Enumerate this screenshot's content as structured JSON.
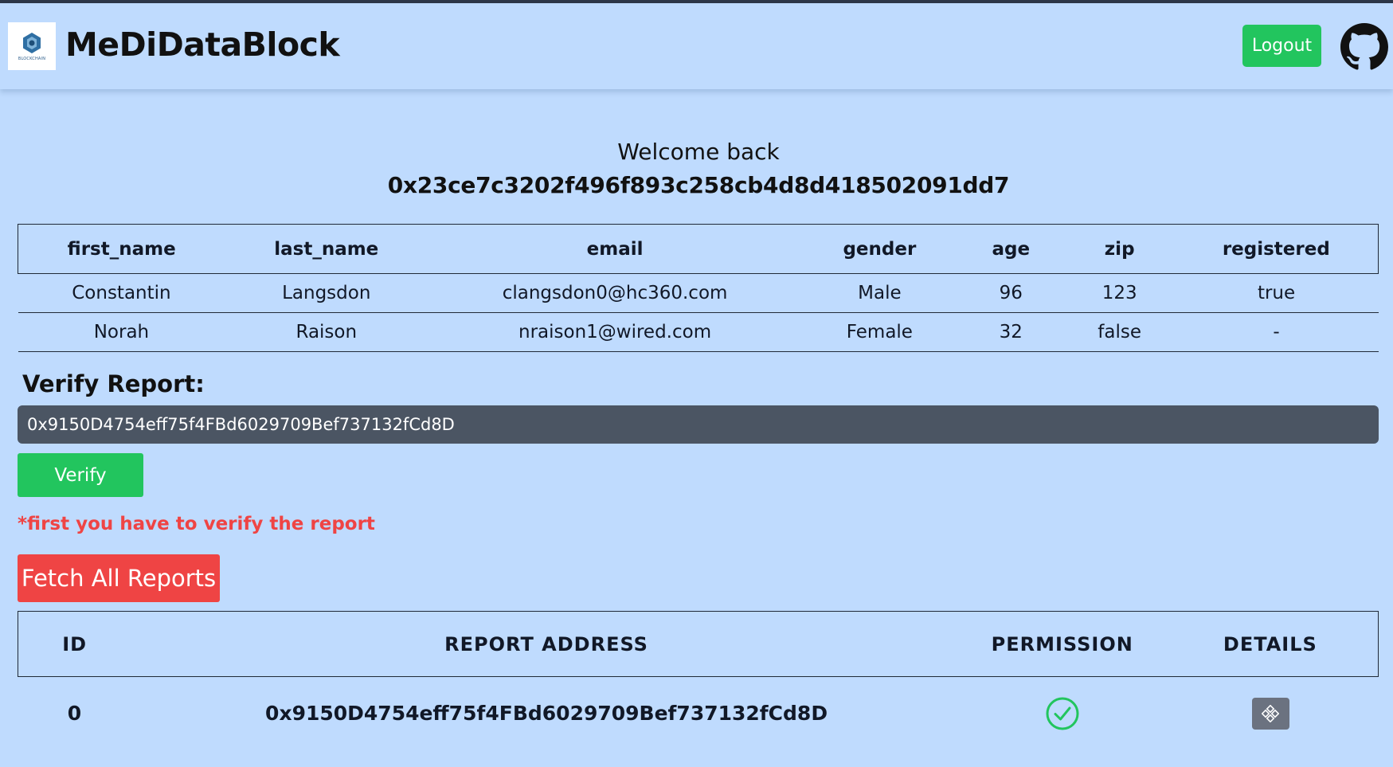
{
  "header": {
    "brand": "MeDiDataBlock",
    "logo_text": "BLOCKCHAIN",
    "logout_label": "Logout"
  },
  "welcome": {
    "greeting": "Welcome back",
    "address": "0x23ce7c3202f496f893c258cb4d8d418502091dd7"
  },
  "users_table": {
    "columns": [
      "first_name",
      "last_name",
      "email",
      "gender",
      "age",
      "zip",
      "registered"
    ],
    "rows": [
      [
        "Constantin",
        "Langsdon",
        "clangsdon0@hc360.com",
        "Male",
        "96",
        "123",
        "true"
      ],
      [
        "Norah",
        "Raison",
        "nraison1@wired.com",
        "Female",
        "32",
        "false",
        "-"
      ]
    ]
  },
  "verify": {
    "label": "Verify Report:",
    "input_value": "0x9150D4754eff75f4FBd6029709Bef737132fCd8D",
    "button_label": "Verify",
    "warning": "*first you have to verify the report"
  },
  "fetch": {
    "button_label": "Fetch All Reports"
  },
  "reports_table": {
    "columns": [
      "ID",
      "REPORT ADDRESS",
      "PERMISSION",
      "DETAILS"
    ],
    "rows": [
      {
        "id": "0",
        "address": "0x9150D4754eff75f4FBd6029709Bef737132fCd8D",
        "permission_icon": "check-circle-icon",
        "details_icon": "details-icon"
      }
    ]
  },
  "colors": {
    "background": "#bfdbfe",
    "success": "#22c55e",
    "danger": "#ef4444",
    "input_bg": "#4b5563",
    "details_btn": "#6b7280"
  }
}
